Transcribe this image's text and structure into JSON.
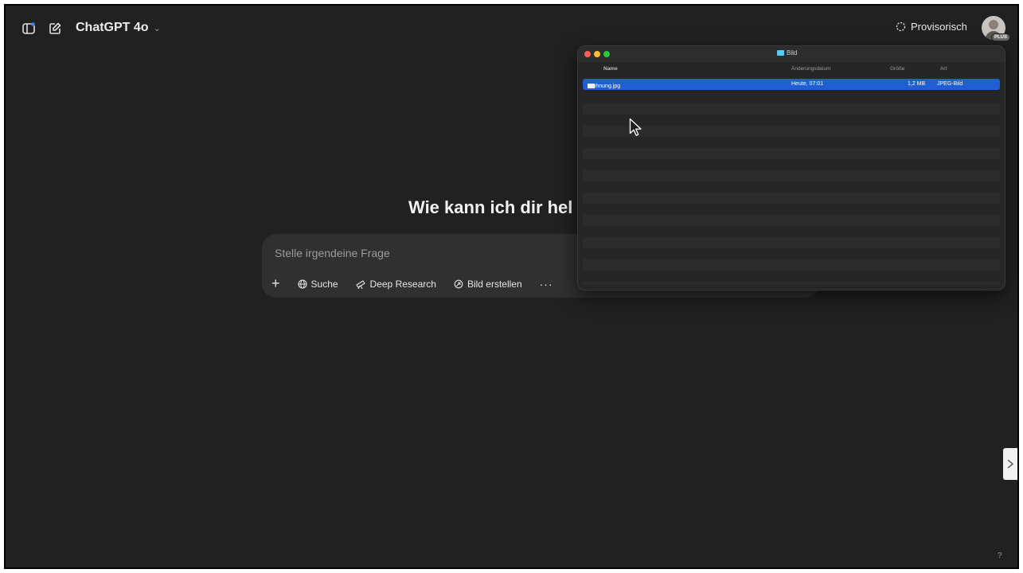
{
  "topbar": {
    "model_label": "ChatGPT 4o",
    "temporary_label": "Provisorisch",
    "plan_badge": "PLUS"
  },
  "main": {
    "headline": "Wie kann ich dir hel",
    "composer": {
      "placeholder": "Stelle irgendeine Frage",
      "tools": {
        "add": "+",
        "search": "Suche",
        "deep_research": "Deep Research",
        "create_image": "Bild erstellen",
        "more": "···"
      }
    }
  },
  "finder": {
    "title": "Bild",
    "columns": {
      "name": "Name",
      "modified": "Änderungsdatum",
      "size": "Größe",
      "kind": "Art"
    },
    "rows": [
      {
        "name": "Wohnung.jpg",
        "modified": "Heute, 07:01",
        "size": "1,2 MB",
        "kind": "JPEG-Bild"
      }
    ]
  },
  "colors": {
    "background": "#212121",
    "composer": "#303030",
    "selection": "#1f5fd1"
  }
}
